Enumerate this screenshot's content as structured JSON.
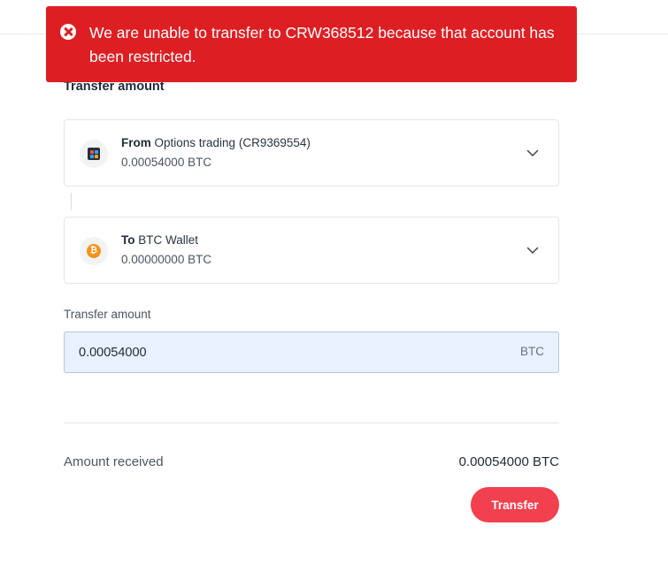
{
  "toast": {
    "message": "We are unable to transfer to CRW368512 because that account has been restricted.",
    "icon": "error-circle-icon",
    "color": "#dd1f24"
  },
  "form": {
    "section_title": "Transfer amount",
    "from": {
      "direction": "From",
      "account": "Options trading (CR9369554)",
      "balance": "0.00054000 BTC",
      "icon": "options-trading-icon"
    },
    "to": {
      "direction": "To",
      "account": "BTC Wallet",
      "balance": "0.00000000 BTC",
      "icon": "bitcoin-icon"
    },
    "amount": {
      "label": "Transfer amount",
      "value": "0.00054000",
      "unit": "BTC"
    },
    "received": {
      "label": "Amount received",
      "value": "0.00054000 BTC"
    },
    "submit_label": "Transfer",
    "accent_color": "#f2404f"
  }
}
